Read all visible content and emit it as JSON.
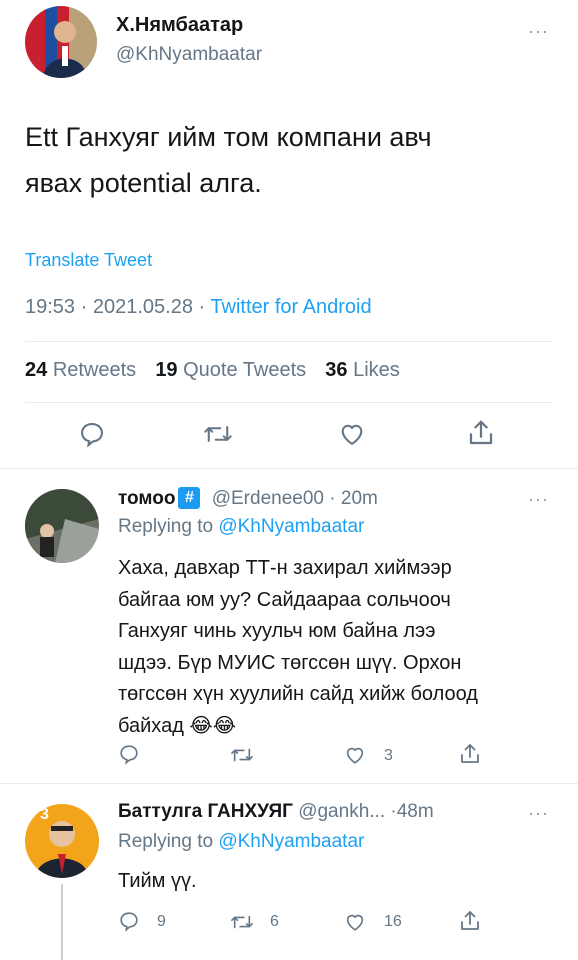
{
  "main_tweet": {
    "author_name": "Х.Нямбаатар",
    "author_handle": "@KhNyambaatar",
    "text_line1": "Ett Ганхуяг ийм том компани авч",
    "text_line2": "явах potential алга.",
    "translate": "Translate Tweet",
    "time": "19:53",
    "sep1": "·",
    "date": "2021.05.28",
    "sep2": "·",
    "source": "Twitter for Android",
    "retweets_count": "24",
    "retweets_label": "Retweets",
    "quotes_count": "19",
    "quotes_label": "Quote Tweets",
    "likes_count": "36",
    "likes_label": "Likes"
  },
  "reply1": {
    "author_name": "томоо",
    "badge": "#",
    "author_handle": "@Erdenee00",
    "sep": "·",
    "time": "20m",
    "replying_prefix": "Replying to",
    "replying_to": "@KhNyambaatar",
    "lines": [
      "Хаха, давхар ТТ-н захирал хиймээр",
      "байгаа юм уу? Сайдаараа сольчооч",
      "Ганхуяг чинь хуульч юм байна лээ",
      "шдээ. Бүр МУИС төгссөн шүү. Орхон",
      "төгссөн хүн хуулийн сайд хийж болоод",
      "байхад 😂😂"
    ],
    "reply_count": "",
    "retweet_count": "",
    "like_count": "3"
  },
  "reply2": {
    "author_name": "Баттулга ГАНХУЯГ",
    "author_handle": "@gankh...",
    "sep": "·",
    "time": "48m",
    "replying_prefix": "Replying to",
    "replying_to": "@KhNyambaatar",
    "text": "Тийм үү.",
    "reply_count": "9",
    "retweet_count": "6",
    "like_count": "16",
    "avatar_badge_text": "3"
  },
  "icons": {
    "more": "more-icon",
    "reply": "reply-icon",
    "retweet": "retweet-icon",
    "like": "heart-icon",
    "share": "share-icon"
  },
  "colors": {
    "link_blue": "#1da1f2",
    "secondary_gray": "#657786",
    "icon_gray": "#657786",
    "divider": "#e6ecf0"
  }
}
